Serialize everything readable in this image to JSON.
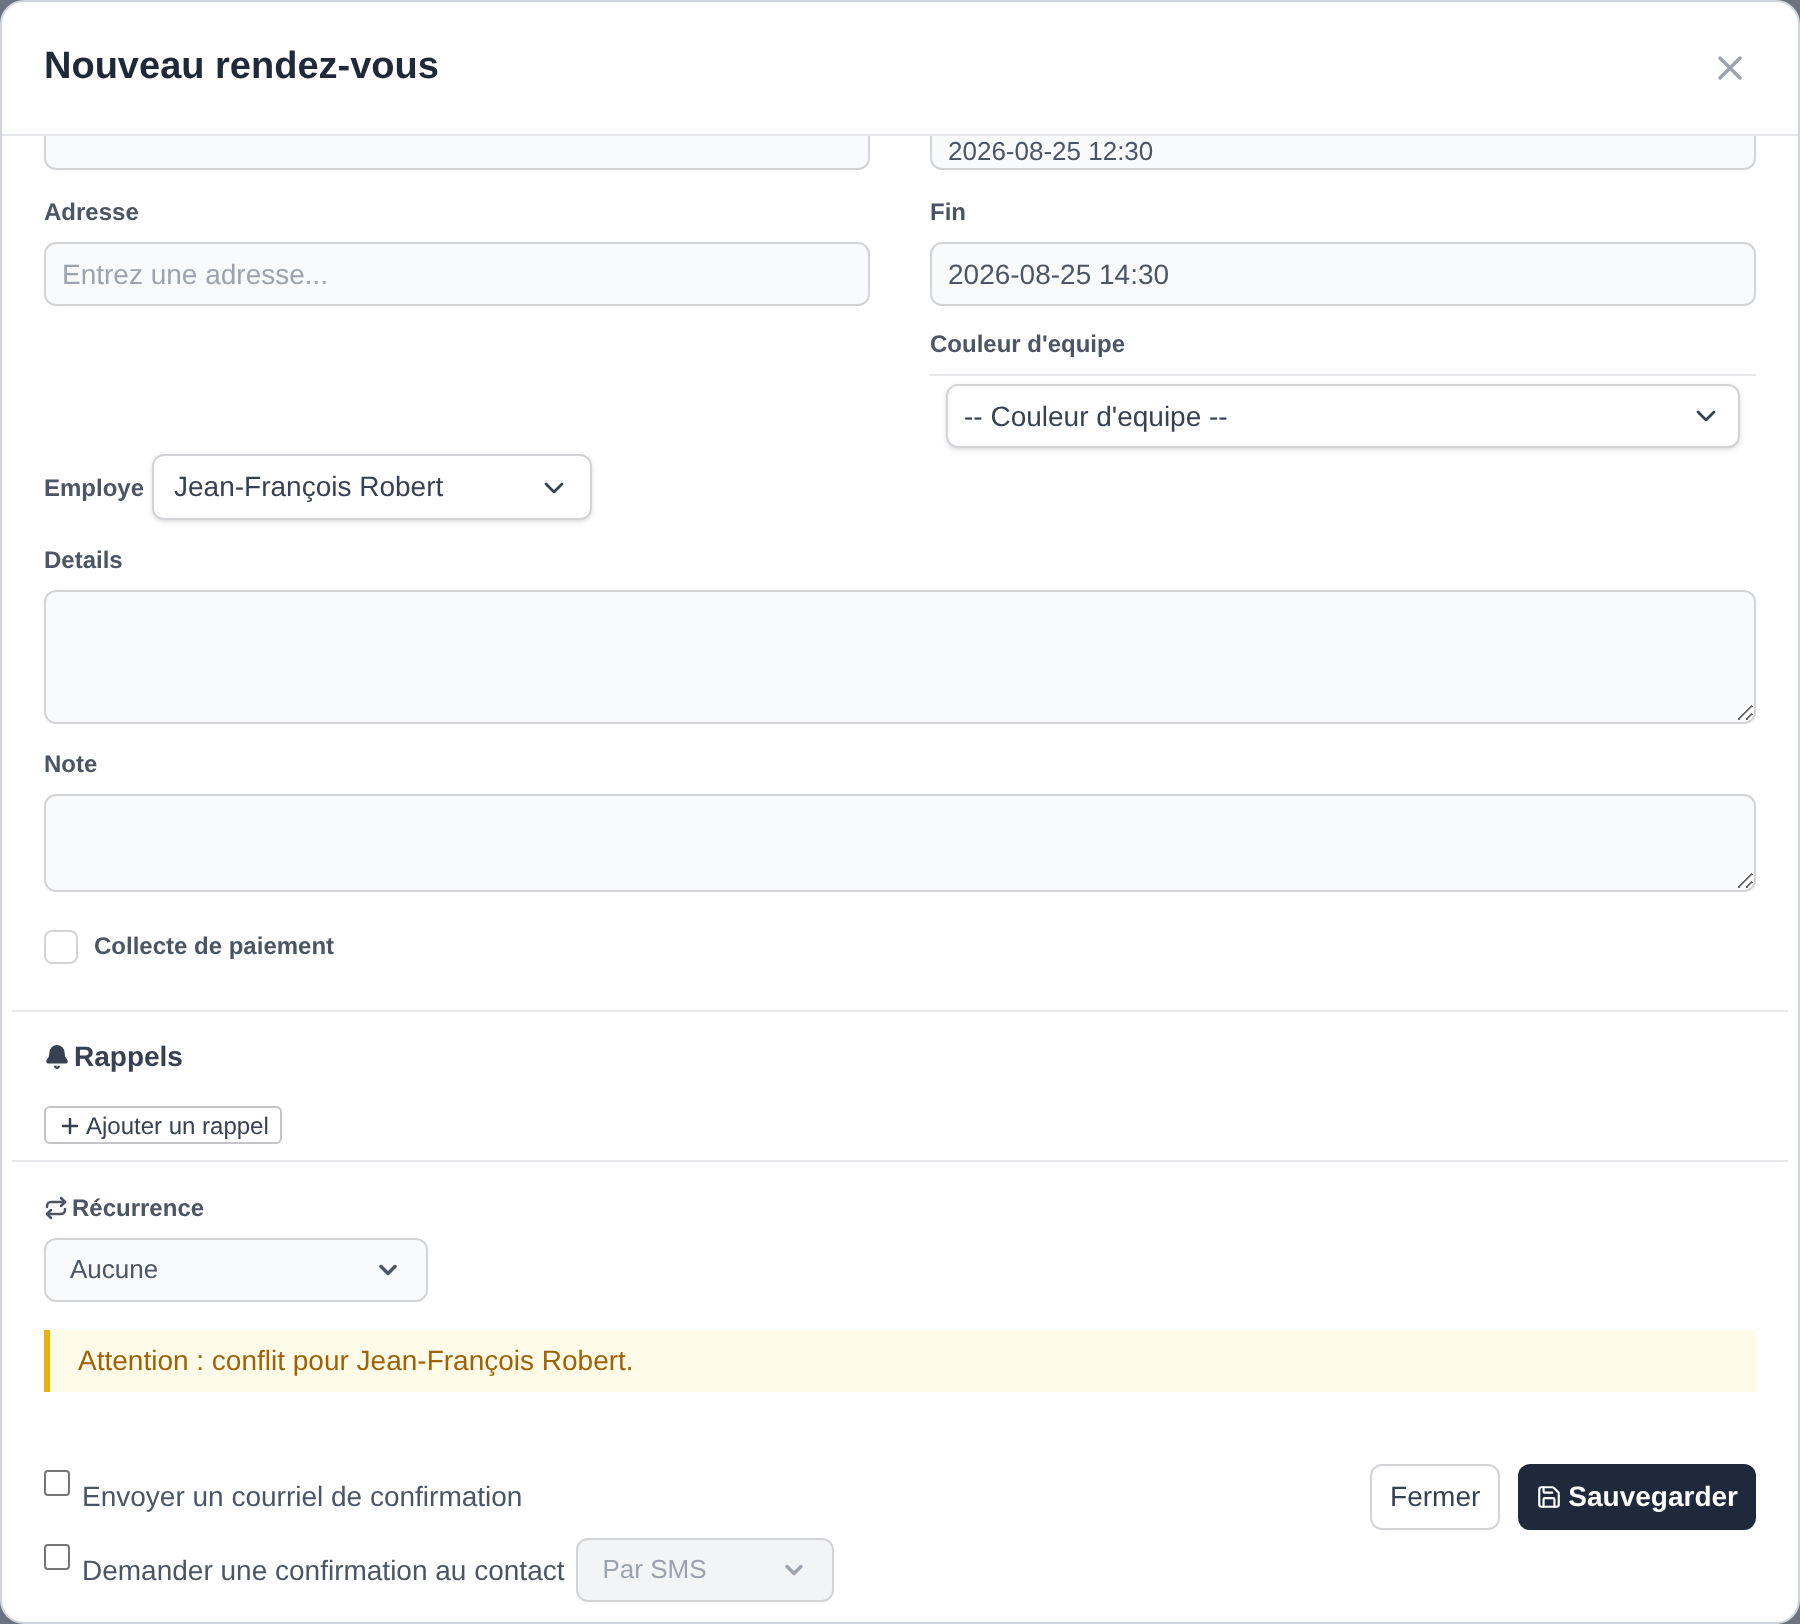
{
  "title": "Nouveau rendez-vous",
  "start": {
    "value": "2026-08-25 12:30"
  },
  "address": {
    "label": "Adresse",
    "placeholder": "Entrez une adresse..."
  },
  "end": {
    "label": "Fin",
    "value": "2026-08-25 14:30"
  },
  "team_color": {
    "label": "Couleur d'equipe",
    "value": "-- Couleur d'equipe --"
  },
  "employee": {
    "label": "Employe",
    "value": "Jean-François Robert"
  },
  "details": {
    "label": "Details"
  },
  "note": {
    "label": "Note"
  },
  "payment": {
    "label": "Collecte de paiement",
    "checked": false
  },
  "reminders": {
    "title": "Rappels",
    "add_button": "Ajouter un rappel"
  },
  "recurrence": {
    "label": "Récurrence",
    "value": "Aucune"
  },
  "alert": "Attention : conflit pour Jean-François Robert.",
  "footer_options": [
    {
      "label": "Envoyer un courriel de confirmation",
      "checked": false
    },
    {
      "label": "Demander une confirmation au contact",
      "checked": false,
      "select": {
        "value": "Par SMS",
        "disabled": true
      }
    }
  ],
  "buttons": [
    {
      "kind": "secondary",
      "label": "Fermer"
    },
    {
      "kind": "primary",
      "label": "Sauvegarder"
    }
  ]
}
